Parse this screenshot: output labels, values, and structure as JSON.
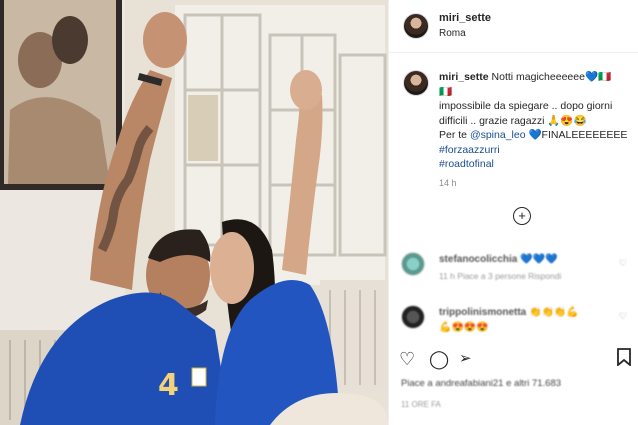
{
  "header": {
    "username": "miri_sette",
    "location": "Roma"
  },
  "post": {
    "author": "miri_sette",
    "caption_line1": "Notti magicheeeeee",
    "caption_line1_emoji": "💙🇮🇹",
    "caption_line2_emoji": "🇮🇹",
    "caption_line3": "impossibile da spiegare .. dopo giorni",
    "caption_line4": "difficili .. grazie ragazzi",
    "caption_line4_emoji": "🙏😍😂",
    "caption_line5_prefix": "Per te",
    "mention": "@spina_leo",
    "caption_line5_suffix": "💙FINALEEEEEEEE",
    "hashtag1": "#forzaazzurri",
    "hashtag2": "#roadtofinal",
    "time_ago": "14 h"
  },
  "load_more_icon": "plus-circle-icon",
  "comments": [
    {
      "username": "stefanocolicchia",
      "text": "💙💙💙",
      "meta": "11 h   Piace a 3 persone   Rispondi"
    },
    {
      "username": "trippolinismonetta",
      "text": "👏👏👏💪",
      "text2": "💪😍😍😍"
    }
  ],
  "actions": {
    "like": "heart-icon",
    "comment": "comment-icon",
    "share": "share-icon",
    "save": "bookmark-icon"
  },
  "likes_text": "Piace a andreafabiani21 e altri 71.683",
  "date_text": "11 ORE FA",
  "colors": {
    "jersey": "#1f4fb4",
    "link": "#1a4d8f",
    "border": "#efefef"
  }
}
